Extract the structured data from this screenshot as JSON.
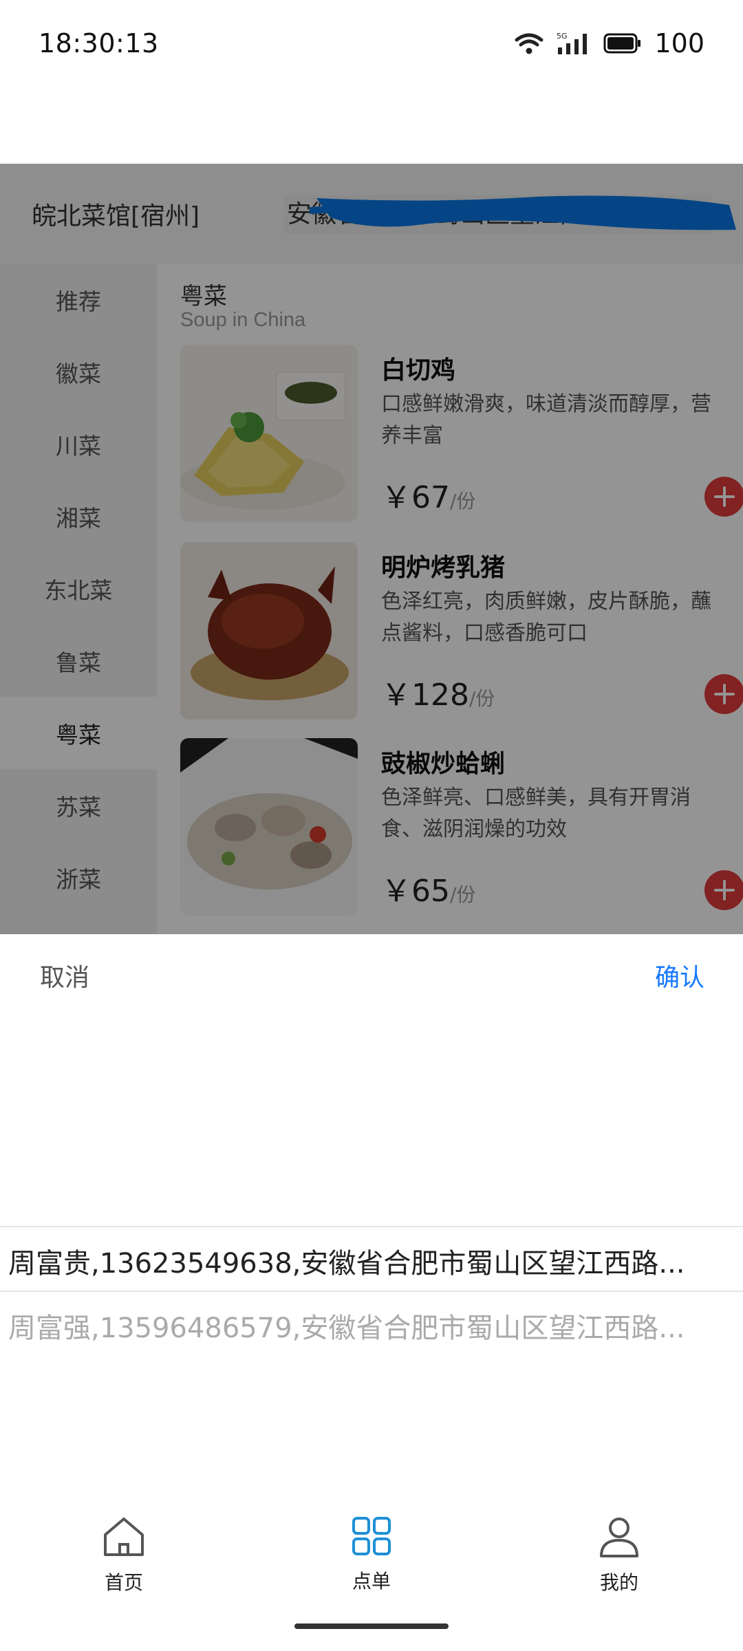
{
  "status_bar": {
    "time": "18:30:13",
    "battery": "100",
    "network_label": "5G"
  },
  "header": {
    "store_name": "皖北菜馆[宿州]",
    "address": "安徽省合肥市蜀山区望江西路"
  },
  "sidebar": {
    "items": [
      {
        "label": "推荐",
        "active": false
      },
      {
        "label": "徽菜",
        "active": false
      },
      {
        "label": "川菜",
        "active": false
      },
      {
        "label": "湘菜",
        "active": false
      },
      {
        "label": "东北菜",
        "active": false
      },
      {
        "label": "鲁菜",
        "active": false
      },
      {
        "label": "粤菜",
        "active": true
      },
      {
        "label": "苏菜",
        "active": false
      },
      {
        "label": "浙菜",
        "active": false
      }
    ]
  },
  "section": {
    "title": "粤菜",
    "subtitle": "Soup in China"
  },
  "dishes": [
    {
      "name": "白切鸡",
      "desc": "口感鲜嫩滑爽，味道清淡而醇厚，营养丰富",
      "price": "￥67",
      "unit": "/份"
    },
    {
      "name": "明炉烤乳猪",
      "desc": "色泽红亮，肉质鲜嫩，皮片酥脆，蘸点酱料，口感香脆可口",
      "price": "￥128",
      "unit": "/份"
    },
    {
      "name": "豉椒炒蛤蜊",
      "desc": "色泽鲜亮、口感鲜美，具有开胃消食、滋阴润燥的功效",
      "price": "￥65",
      "unit": "/份"
    }
  ],
  "picker": {
    "cancel_label": "取消",
    "confirm_label": "确认",
    "options": [
      "周富贵,13623549638,安徽省合肥市蜀山区望江西路...",
      "周富强,13596486579,安徽省合肥市蜀山区望江西路..."
    ]
  },
  "bottom_nav": {
    "items": [
      {
        "label": "首页",
        "icon": "home-icon"
      },
      {
        "label": "点单",
        "icon": "grid-icon",
        "active": true
      },
      {
        "label": "我的",
        "icon": "user-icon"
      }
    ]
  },
  "colors": {
    "accent": "#1677ff",
    "add_button": "#e03b3b"
  }
}
